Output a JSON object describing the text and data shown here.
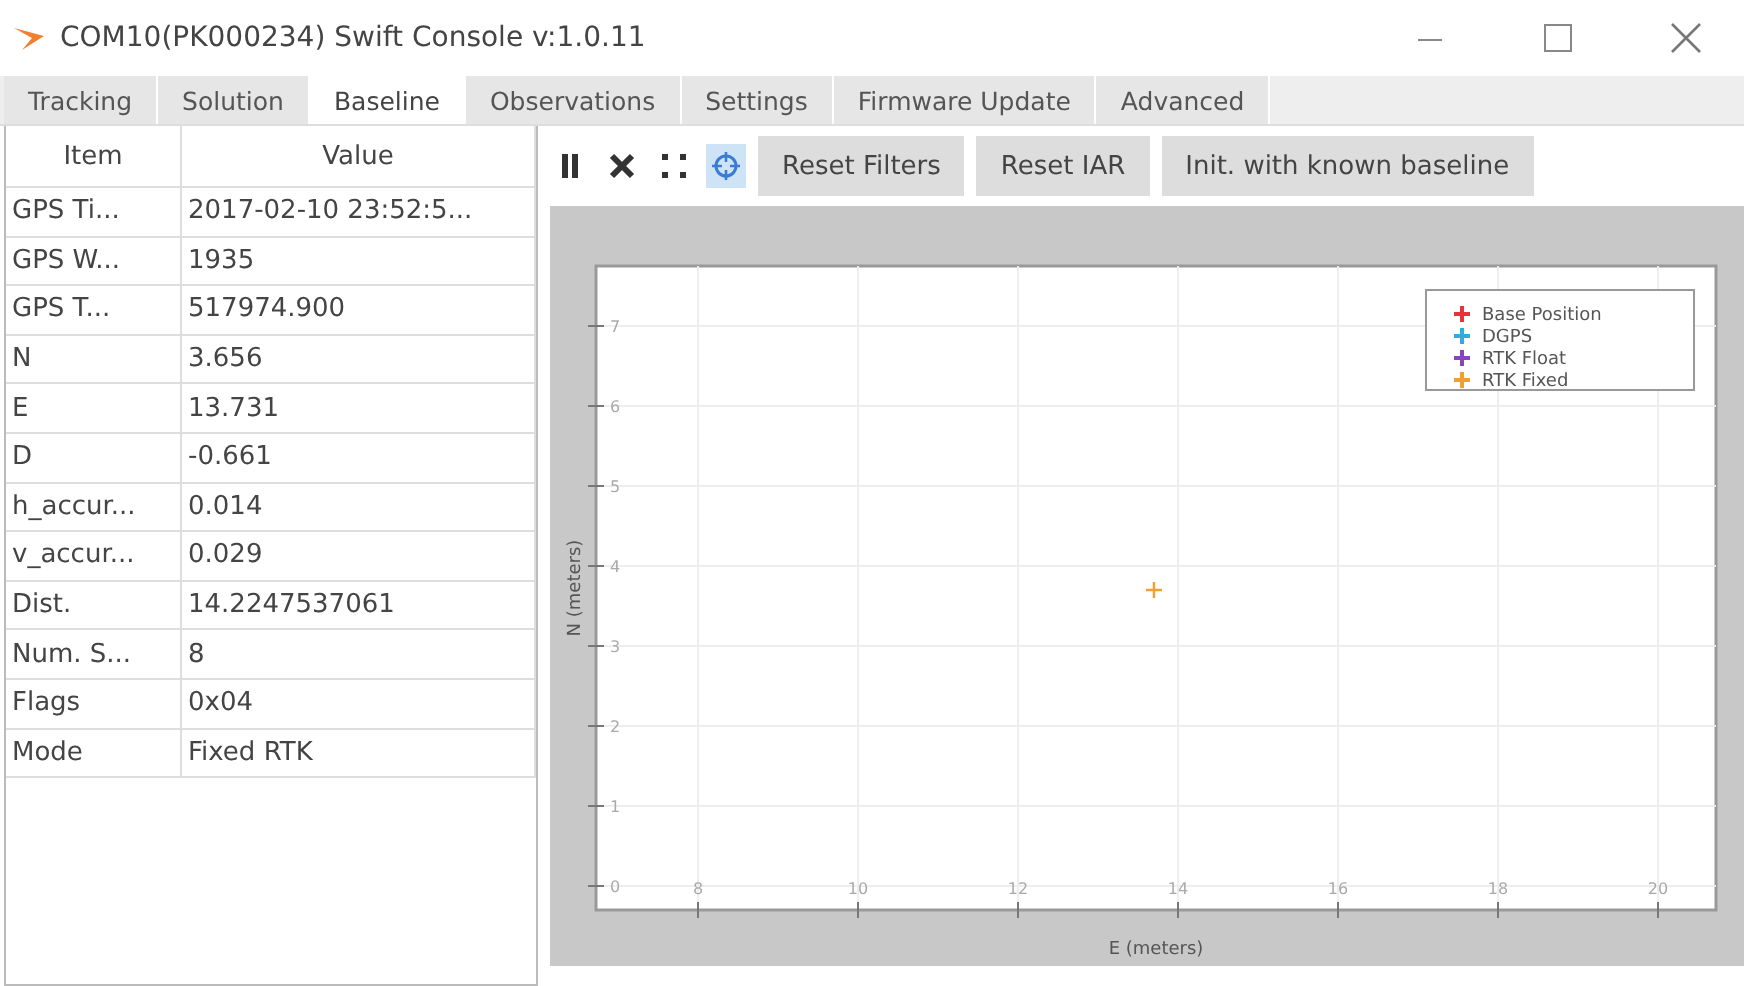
{
  "window": {
    "title": "COM10(PK000234) Swift Console v:1.0.11"
  },
  "tabs": [
    {
      "label": "Tracking",
      "selected": false
    },
    {
      "label": "Solution",
      "selected": false
    },
    {
      "label": "Baseline",
      "selected": true
    },
    {
      "label": "Observations",
      "selected": false
    },
    {
      "label": "Settings",
      "selected": false
    },
    {
      "label": "Firmware Update",
      "selected": false
    },
    {
      "label": "Advanced",
      "selected": false
    }
  ],
  "table": {
    "columns": [
      "Item",
      "Value"
    ],
    "rows": [
      [
        "GPS Ti...",
        "2017-02-10 23:52:5..."
      ],
      [
        "GPS W...",
        "1935"
      ],
      [
        "GPS T...",
        "517974.900"
      ],
      [
        "N",
        "3.656"
      ],
      [
        "E",
        "13.731"
      ],
      [
        "D",
        "-0.661"
      ],
      [
        "h_accur...",
        "0.014"
      ],
      [
        "v_accur...",
        "0.029"
      ],
      [
        "Dist.",
        "14.2247537061"
      ],
      [
        "Num. S...",
        "8"
      ],
      [
        "Flags",
        "0x04"
      ],
      [
        "Mode",
        "Fixed RTK"
      ]
    ]
  },
  "toolbar": {
    "tools": [
      {
        "kind": "pause",
        "selected": false
      },
      {
        "kind": "clear",
        "selected": false
      },
      {
        "kind": "zoom",
        "selected": false
      },
      {
        "kind": "center",
        "selected": true
      }
    ],
    "buttons": [
      "Reset Filters",
      "Reset IAR",
      "Init. with known baseline"
    ]
  },
  "plot": {
    "chart_data": {
      "type": "scatter",
      "xlabel": "E (meters)",
      "ylabel": "N (meters)",
      "x": [
        13.7
      ],
      "grid": true,
      "series": [
        {
          "name": "Base Position",
          "color": "#e8323c",
          "values": [
            null
          ]
        },
        {
          "name": "DGPS",
          "color": "#33aadd",
          "values": [
            null
          ]
        },
        {
          "name": "RTK Float",
          "color": "#8844bb",
          "values": [
            null
          ]
        },
        {
          "name": "RTK Fixed",
          "color": "#f0a030",
          "values": [
            3.7
          ]
        }
      ],
      "xlim": [
        6.725,
        20.725
      ],
      "ylim": [
        -0.3,
        7.75
      ],
      "xticks": [
        8,
        10,
        12,
        14,
        16,
        18,
        20
      ],
      "yticks": [
        0,
        1,
        2,
        3,
        4,
        5,
        6,
        7
      ]
    }
  }
}
